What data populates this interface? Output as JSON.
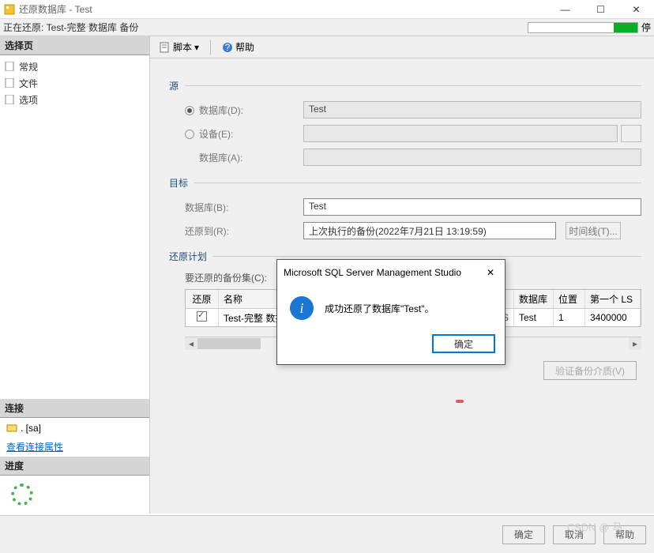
{
  "window": {
    "title": "还原数据库 - Test"
  },
  "status": {
    "text": "正在还原: Test-完整 数据库 备份",
    "stop": "停"
  },
  "sidebar": {
    "header": "选择页",
    "items": [
      "常规",
      "文件",
      "选项"
    ],
    "conn_header": "连接",
    "conn_item": ". [sa]",
    "view_link": "查看连接属性",
    "progress_header": "进度"
  },
  "toolbar": {
    "script": "脚本",
    "help": "帮助"
  },
  "source": {
    "title": "源",
    "database_label": "数据库(D):",
    "device_label": "设备(E):",
    "database2_label": "数据库(A):",
    "database_value": "Test"
  },
  "target": {
    "title": "目标",
    "database_label": "数据库(B):",
    "database_value": "Test",
    "restore_to_label": "还原到(R):",
    "restore_to_value": "上次执行的备份(2022年7月21日 13:19:59)",
    "timeline_btn": "时间线(T)..."
  },
  "plan": {
    "title": "还原计划",
    "sets_label": "要还原的备份集(C):",
    "cols": {
      "restore": "还原",
      "name": "名称",
      "db": "数据库",
      "pos": "位置",
      "lsn": "第一个 LS"
    },
    "row": {
      "name": "Test-完整 数据库",
      "extra": "PRESS",
      "db": "Test",
      "pos": "1",
      "lsn": "3400000"
    }
  },
  "verify_btn": "验证备份介质(V)",
  "footer": {
    "ok": "确定",
    "cancel": "取消",
    "help": "帮助"
  },
  "dialog": {
    "title": "Microsoft SQL Server Management Studio",
    "message": "成功还原了数据库\"Test\"。",
    "ok": "确定"
  },
  "watermark": "CSDN @ 马"
}
